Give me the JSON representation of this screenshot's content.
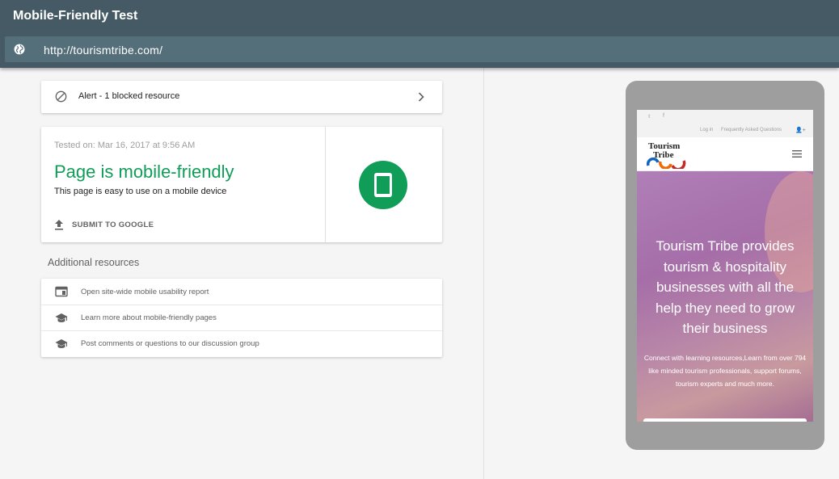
{
  "app": {
    "title": "Mobile-Friendly Test"
  },
  "url_bar": {
    "url": "http://tourismtribe.com/",
    "icon": "globe-icon"
  },
  "alert": {
    "text": "Alert - 1 blocked resource",
    "icon": "blocked-icon",
    "chevron": "chevron-right-icon"
  },
  "result": {
    "tested_on": "Tested on: Mar 16, 2017 at 9:56 AM",
    "headline": "Page is mobile-friendly",
    "subline": "This page is easy to use on a mobile device",
    "submit_label": "SUBMIT TO GOOGLE",
    "badge_icon": "smartphone-icon",
    "accent_color": "#0f9d58"
  },
  "additional": {
    "title": "Additional resources",
    "items": [
      {
        "label": "Open site-wide mobile usability report",
        "icon": "report-icon"
      },
      {
        "label": "Learn more about mobile-friendly pages",
        "icon": "school-icon"
      },
      {
        "label": "Post comments or questions to our discussion group",
        "icon": "school-icon"
      }
    ]
  },
  "preview": {
    "top_links": {
      "twitter": "𝕥",
      "facebook": "f",
      "login": "Log in",
      "faq": "Frequently Asked Questions",
      "user": "👤+"
    },
    "logo": {
      "line1": "Tourism",
      "line2": "Tribe"
    },
    "hero_title": "Tourism Tribe provides tourism & hospitality businesses with all the help they need to grow their business",
    "hero_sub": "Connect with learning resources,Learn from over 794 like minded tourism professionals,  support forums, tourism experts and much more."
  },
  "colors": {
    "header": "#455a64",
    "url_bar": "#546e7a",
    "green": "#0f9d58"
  }
}
